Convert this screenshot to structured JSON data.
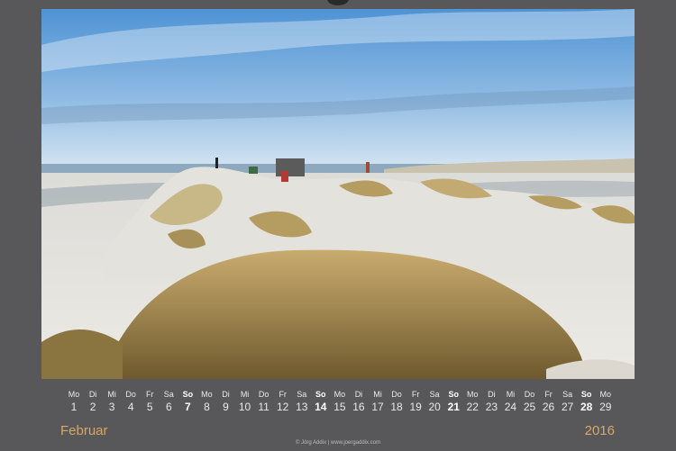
{
  "calendar": {
    "month": "Februar",
    "year": "2016",
    "credit": "© Jörg Addix | www.joergaddix.com",
    "days": [
      {
        "wd": "Mo",
        "num": "1",
        "sun": false
      },
      {
        "wd": "Di",
        "num": "2",
        "sun": false
      },
      {
        "wd": "Mi",
        "num": "3",
        "sun": false
      },
      {
        "wd": "Do",
        "num": "4",
        "sun": false
      },
      {
        "wd": "Fr",
        "num": "5",
        "sun": false
      },
      {
        "wd": "Sa",
        "num": "6",
        "sun": false
      },
      {
        "wd": "So",
        "num": "7",
        "sun": true
      },
      {
        "wd": "Mo",
        "num": "8",
        "sun": false
      },
      {
        "wd": "Di",
        "num": "9",
        "sun": false
      },
      {
        "wd": "Mi",
        "num": "10",
        "sun": false
      },
      {
        "wd": "Do",
        "num": "11",
        "sun": false
      },
      {
        "wd": "Fr",
        "num": "12",
        "sun": false
      },
      {
        "wd": "Sa",
        "num": "13",
        "sun": false
      },
      {
        "wd": "So",
        "num": "14",
        "sun": true
      },
      {
        "wd": "Mo",
        "num": "15",
        "sun": false
      },
      {
        "wd": "Di",
        "num": "16",
        "sun": false
      },
      {
        "wd": "Mi",
        "num": "17",
        "sun": false
      },
      {
        "wd": "Do",
        "num": "18",
        "sun": false
      },
      {
        "wd": "Fr",
        "num": "19",
        "sun": false
      },
      {
        "wd": "Sa",
        "num": "20",
        "sun": false
      },
      {
        "wd": "So",
        "num": "21",
        "sun": true
      },
      {
        "wd": "Mo",
        "num": "22",
        "sun": false
      },
      {
        "wd": "Di",
        "num": "23",
        "sun": false
      },
      {
        "wd": "Mi",
        "num": "24",
        "sun": false
      },
      {
        "wd": "Do",
        "num": "25",
        "sun": false
      },
      {
        "wd": "Fr",
        "num": "26",
        "sun": false
      },
      {
        "wd": "Sa",
        "num": "27",
        "sun": false
      },
      {
        "wd": "So",
        "num": "28",
        "sun": true
      },
      {
        "wd": "Mo",
        "num": "29",
        "sun": false
      }
    ]
  },
  "colors": {
    "background": "#58585a",
    "accent": "#d8a869",
    "text": "#e9e9e9"
  }
}
